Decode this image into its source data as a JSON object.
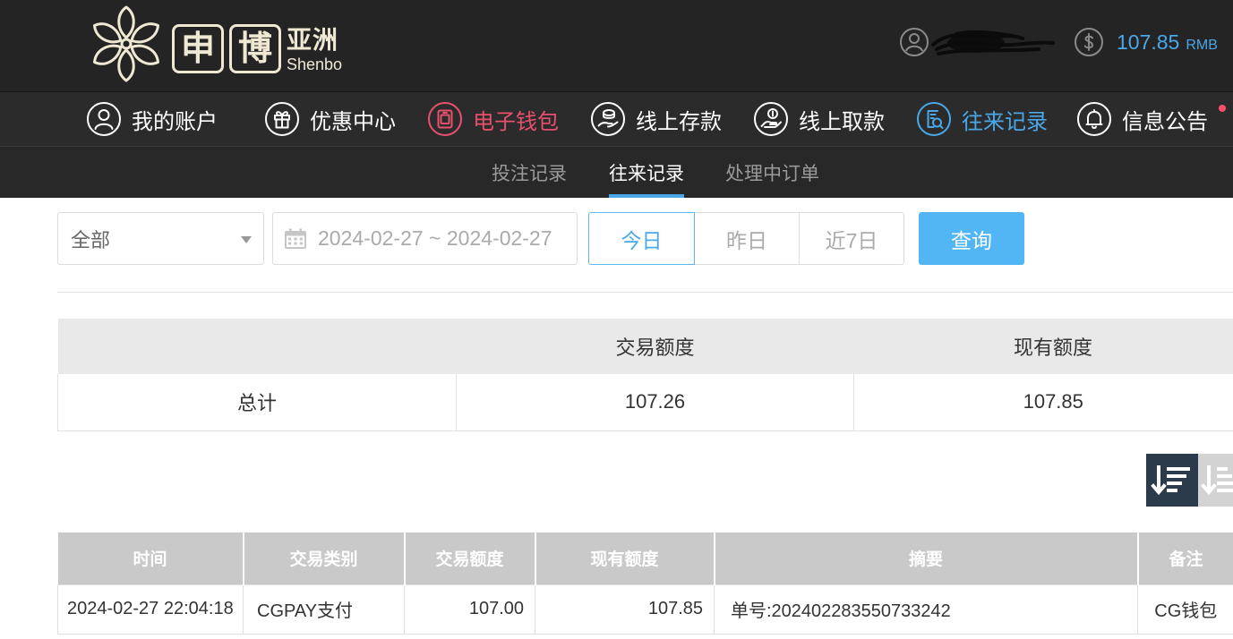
{
  "header": {
    "logo": {
      "mark_icon": "lotus-flower-icon",
      "char_1": "申",
      "char_2": "博",
      "region": "亚洲",
      "latin": "Shenbo"
    },
    "user_icon": "user-avatar-icon",
    "balance": {
      "icon": "dollar-coin-icon",
      "amount": "107.85",
      "currency": "RMB"
    }
  },
  "nav": {
    "items": [
      {
        "label": "我的账户",
        "icon": "user-icon",
        "active": false
      },
      {
        "label": "优惠中心",
        "icon": "gift-icon",
        "active": false
      },
      {
        "label": "电子钱包",
        "icon": "wallet-icon",
        "active": false,
        "color": "#e8506e"
      },
      {
        "label": "线上存款",
        "icon": "deposit-icon",
        "active": false
      },
      {
        "label": "线上取款",
        "icon": "withdraw-icon",
        "active": false
      },
      {
        "label": "往来记录",
        "icon": "records-icon",
        "active": true
      },
      {
        "label": "信息公告",
        "icon": "bell-icon",
        "active": false,
        "unread_dot": true
      }
    ]
  },
  "subnav": {
    "tabs": [
      {
        "label": "投注记录",
        "active": false
      },
      {
        "label": "往来记录",
        "active": true
      },
      {
        "label": "处理中订单",
        "active": false
      }
    ]
  },
  "filters": {
    "type_select": {
      "value": "全部",
      "icon": "chevron-down-icon"
    },
    "date_range": {
      "icon": "calendar-icon",
      "value": "2024-02-27 ~ 2024-02-27"
    },
    "quick_ranges": [
      {
        "label": "今日",
        "active": true
      },
      {
        "label": "昨日",
        "active": false
      },
      {
        "label": "近7日",
        "active": false
      }
    ],
    "query_button": "查询"
  },
  "summary": {
    "columns": [
      "",
      "交易额度",
      "现有额度"
    ],
    "rows": [
      [
        "总计",
        "107.26",
        "107.85"
      ]
    ]
  },
  "sort": {
    "buttons": [
      {
        "icon": "sort-descending-icon",
        "active": true
      },
      {
        "icon": "sort-ascending-icon",
        "active": false
      }
    ]
  },
  "transactions": {
    "columns": [
      "时间",
      "交易类别",
      "交易额度",
      "现有额度",
      "摘要",
      "备注"
    ],
    "rows": [
      [
        "2024-02-27 22:04:18",
        "CGPAY支付",
        "107.00",
        "107.85",
        "单号:202402283550733242",
        "CG钱包"
      ]
    ]
  },
  "colors": {
    "header_bg": "#242424",
    "accent": "#4aa8e8",
    "wallet_highlight": "#e8506e",
    "query_button": "#52b6f5",
    "sort_active_bg": "#2c3b4c",
    "notice_dot": "#ff4d6d"
  }
}
